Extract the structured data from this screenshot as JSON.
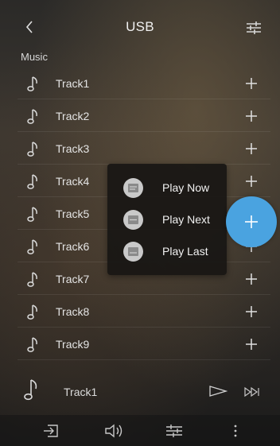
{
  "header": {
    "title": "USB",
    "back_icon": "chevron-left-icon",
    "filter_icon": "filter-icon"
  },
  "section": {
    "label": "Music"
  },
  "tracks": [
    "Track1",
    "Track2",
    "Track3",
    "Track4",
    "Track5",
    "Track6",
    "Track7",
    "Track8",
    "Track9"
  ],
  "menu": {
    "items": [
      "Play Now",
      "Play Next",
      "Play Last"
    ]
  },
  "now_playing": {
    "track": "Track1"
  },
  "colors": {
    "accent": "#4aa3e0",
    "text": "#e8e8e8"
  },
  "bottom_bar": {
    "icons": [
      "exit-icon",
      "volume-icon",
      "equalizer-icon",
      "more-icon"
    ]
  }
}
